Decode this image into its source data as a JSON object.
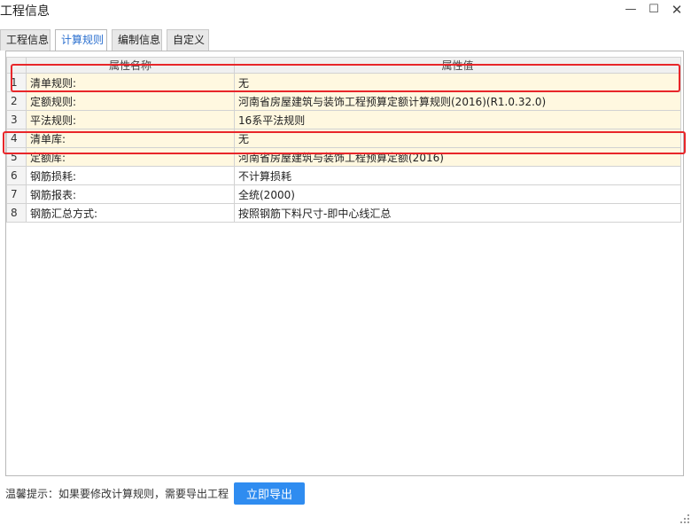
{
  "window": {
    "title": "工程信息",
    "minimize_glyph": "—",
    "maximize_glyph": "☐",
    "close_glyph": "✕"
  },
  "tabs": [
    {
      "label": "工程信息",
      "active": false
    },
    {
      "label": "计算规则",
      "active": true
    },
    {
      "label": "编制信息",
      "active": false
    },
    {
      "label": "自定义",
      "active": false
    }
  ],
  "table": {
    "headers": {
      "name": "属性名称",
      "value": "属性值"
    },
    "rows": [
      {
        "num": "1",
        "name": "清单规则:",
        "value": "无"
      },
      {
        "num": "2",
        "name": "定额规则:",
        "value": "河南省房屋建筑与装饰工程预算定额计算规则(2016)(R1.0.32.0)"
      },
      {
        "num": "3",
        "name": "平法规则:",
        "value": "16系平法规则"
      },
      {
        "num": "4",
        "name": "清单库:",
        "value": "无"
      },
      {
        "num": "5",
        "name": "定额库:",
        "value": "河南省房屋建筑与装饰工程预算定额(2016)"
      },
      {
        "num": "6",
        "name": "钢筋损耗:",
        "value": "不计算损耗"
      },
      {
        "num": "7",
        "name": "钢筋报表:",
        "value": "全统(2000)"
      },
      {
        "num": "8",
        "name": "钢筋汇总方式:",
        "value": "按照钢筋下料尺寸-即中心线汇总"
      }
    ]
  },
  "footer": {
    "tip": "温馨提示：如果要修改计算规则，需要导出工程",
    "export_label": "立即导出"
  },
  "colors": {
    "accent": "#2f8cf0",
    "highlight_box": "#e8262a",
    "config_row_bg": "#fff8e0"
  }
}
